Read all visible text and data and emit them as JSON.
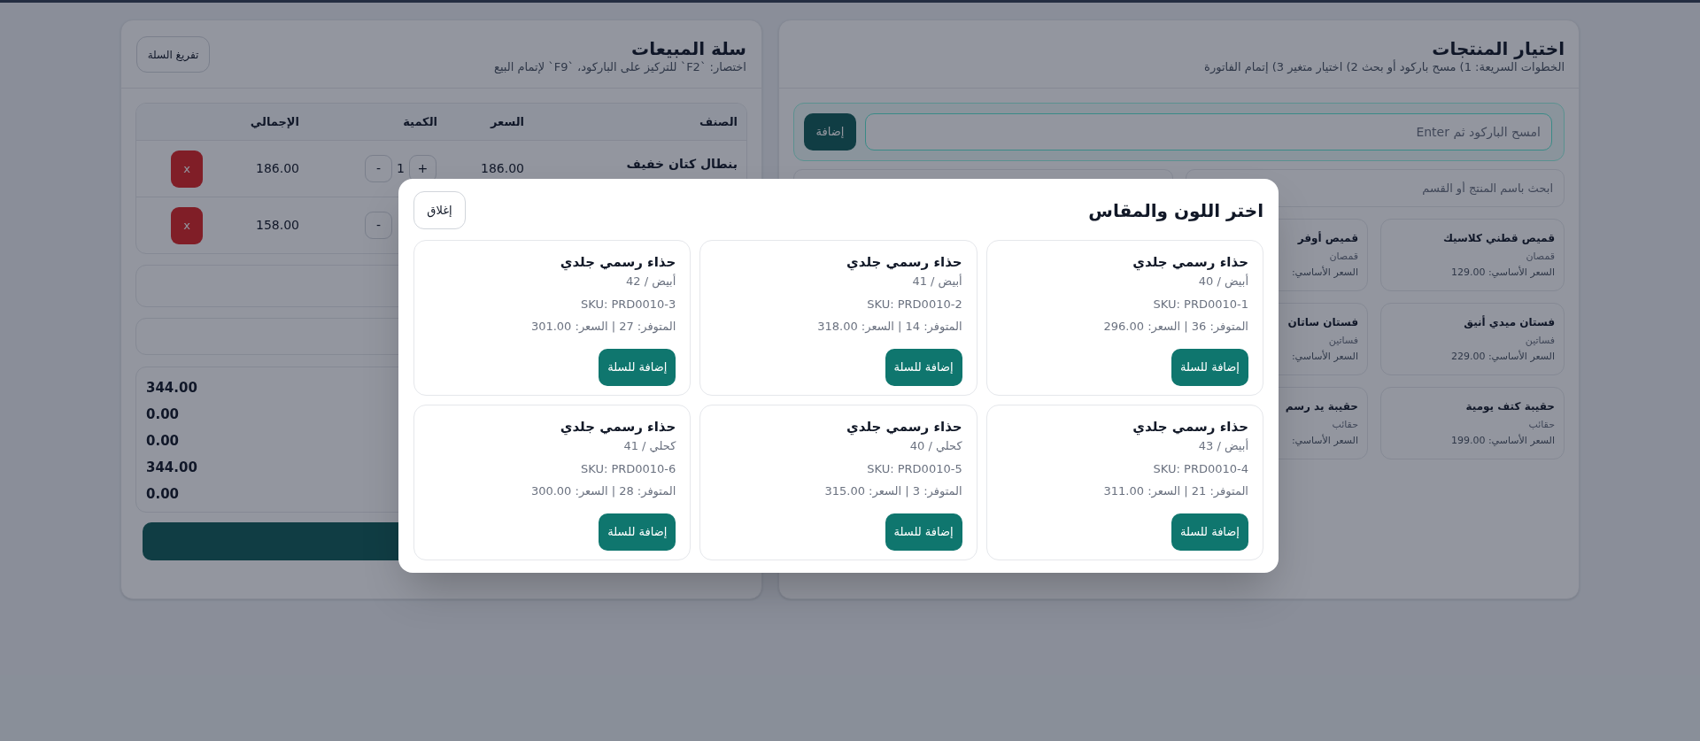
{
  "products_panel": {
    "title": "اختيار المنتجات",
    "subtitle": "الخطوات السريعة: 1) مسح باركود أو بحث 2) اختيار متغير 3) إتمام الفاتورة",
    "barcode": {
      "placeholder": "امسح الباركود ثم Enter",
      "button": "إضافة"
    },
    "search": {
      "placeholder": "ابحث باسم المنتج أو القسم"
    },
    "products": [
      {
        "name": "قميص قطني كلاسيك",
        "category": "قمصان",
        "price": "السعر الأساسي: 129.00"
      },
      {
        "name": "قميص أوفر",
        "category": "قمصان",
        "price": "السعر الأساسي:"
      },
      {
        "name": "فستان ميدي أنيق",
        "category": "فساتين",
        "price": "السعر الأساسي: 229.00"
      },
      {
        "name": "فستان ساتان",
        "category": "فساتين",
        "price": "السعر الأساسي:"
      },
      {
        "name": "حقيبة كتف يومية",
        "category": "حقائب",
        "price": "السعر الأساسي: 199.00"
      },
      {
        "name": "حقيبة يد رسم",
        "category": "حقائب",
        "price": "السعر الأساسي:"
      }
    ]
  },
  "cart_panel": {
    "title": "سلة المبيعات",
    "subtitle": "اختصار: `F2` للتركيز على الباركود، `F9` لإتمام البيع",
    "clear_button": "تفريغ السلة",
    "columns": [
      "الصنف",
      "السعر",
      "الكمية",
      "الإجمالي"
    ],
    "rows": [
      {
        "name": "بنطال كتان خفيف",
        "price": "186.00",
        "plus": "+",
        "quantity": "1",
        "minus": "-",
        "total": "186.00",
        "remove": "x"
      },
      {
        "minus": "-",
        "total": "158.00",
        "remove": "x"
      }
    ],
    "totals": [
      {
        "value": "344.00"
      },
      {
        "value": "0.00"
      },
      {
        "value": "0.00"
      },
      {
        "value": "344.00"
      },
      {
        "value": "0.00"
      }
    ]
  },
  "variant_dialog": {
    "title": "اختر اللون والمقاس",
    "close_button": "إغلاق",
    "variants": [
      {
        "name": "حذاء رسمي جلدي",
        "option": "أبيض / 40",
        "sku": "SKU: PRD0010-1",
        "stock_price": "المتوفر: 36 | السعر: 296.00",
        "button": "إضافة للسلة"
      },
      {
        "name": "حذاء رسمي جلدي",
        "option": "أبيض / 41",
        "sku": "SKU: PRD0010-2",
        "stock_price": "المتوفر: 14 | السعر: 318.00",
        "button": "إضافة للسلة"
      },
      {
        "name": "حذاء رسمي جلدي",
        "option": "أبيض / 42",
        "sku": "SKU: PRD0010-3",
        "stock_price": "المتوفر: 27 | السعر: 301.00",
        "button": "إضافة للسلة"
      },
      {
        "name": "حذاء رسمي جلدي",
        "option": "أبيض / 43",
        "sku": "SKU: PRD0010-4",
        "stock_price": "المتوفر: 21 | السعر: 311.00",
        "button": "إضافة للسلة"
      },
      {
        "name": "حذاء رسمي جلدي",
        "option": "كحلي / 40",
        "sku": "SKU: PRD0010-5",
        "stock_price": "المتوفر: 3 | السعر: 315.00",
        "button": "إضافة للسلة"
      },
      {
        "name": "حذاء رسمي جلدي",
        "option": "كحلي / 41",
        "sku": "SKU: PRD0010-6",
        "stock_price": "المتوفر: 28 | السعر: 300.00",
        "button": "إضافة للسلة"
      }
    ]
  }
}
